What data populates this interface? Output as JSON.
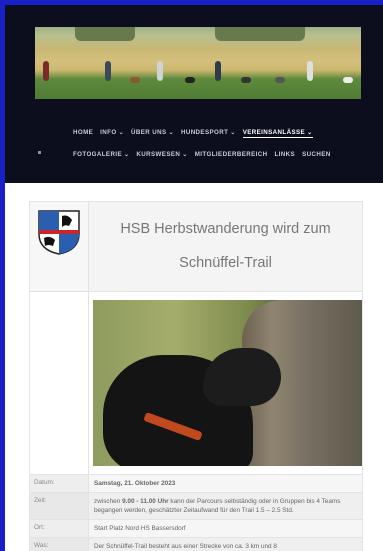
{
  "nav": {
    "row1": [
      {
        "label": "HOME",
        "chevron": false,
        "active": false
      },
      {
        "label": "INFO",
        "chevron": true,
        "active": false
      },
      {
        "label": "ÜBER UNS",
        "chevron": true,
        "active": false
      },
      {
        "label": "HUNDESPORT",
        "chevron": true,
        "active": false
      },
      {
        "label": "VEREINSANLÄSSE",
        "chevron": true,
        "active": true
      }
    ],
    "row2": [
      {
        "label": "FOTOGALERIE",
        "chevron": true,
        "active": false
      },
      {
        "label": "KURSWESEN",
        "chevron": true,
        "active": false
      },
      {
        "label": "MITGLIEDERBEREICH",
        "chevron": false,
        "active": false
      },
      {
        "label": "LINKS",
        "chevron": false,
        "active": false
      },
      {
        "label": "SUCHEN",
        "chevron": false,
        "active": false
      }
    ],
    "chevron_icon": "chevron-down-icon"
  },
  "event": {
    "title_line1": "HSB Herbstwanderung wird zum",
    "title_line2": "Schnüffel-Trail",
    "rows": [
      {
        "label": "Datum:",
        "strong": "Samstag, 21. Oktober 2023",
        "text": ""
      },
      {
        "label": "Zeit:",
        "pre": "zwischen ",
        "strong": "9.00 - 11.00 Uhr",
        "text": " kann der Parcours selbständig oder in Gruppen bis 4 Teams begangen werden, geschätzter Zeitaufwand für den Trail 1.5 – 2.5 Std."
      },
      {
        "label": "Ort:",
        "strong": "",
        "text": "Start Platz Nord HS Bassersdorf"
      },
      {
        "label": "Was:",
        "strong": "",
        "text": "Der Schnüffel-Trail besteht aus einer Strecke von ca. 3 km und 8"
      }
    ]
  },
  "colors": {
    "page_border": "#1a20c8",
    "header_bg": "#0c0e1e"
  }
}
